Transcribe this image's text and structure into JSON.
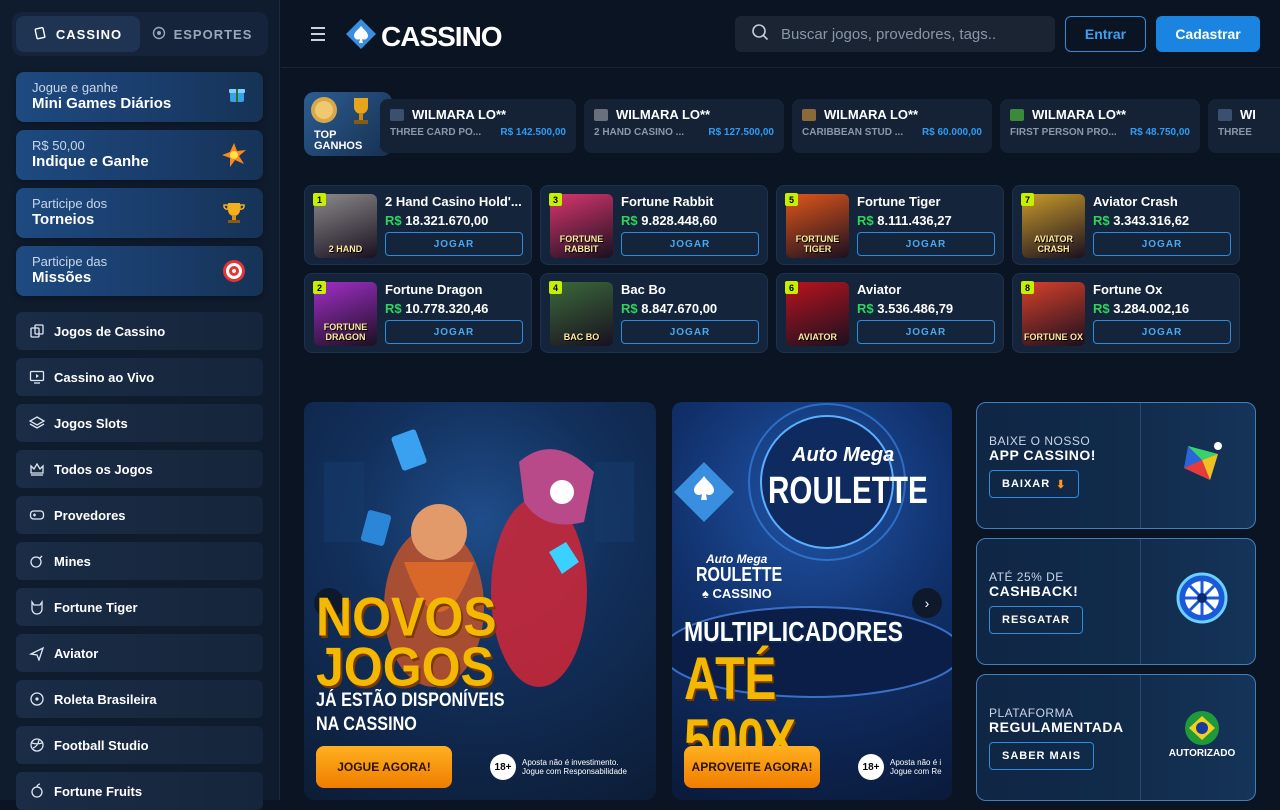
{
  "sidebar": {
    "tabs": [
      {
        "label": "CASSINO",
        "icon": "casino-icon",
        "active": true
      },
      {
        "label": "ESPORTES",
        "icon": "soccer-icon",
        "active": false
      }
    ],
    "promos": [
      {
        "small": "Jogue e ganhe",
        "big": "Mini Games Diários",
        "icon": "gift-icon"
      },
      {
        "small": "R$ 50,00",
        "big": "Indique e Ganhe",
        "icon": "burst-icon"
      },
      {
        "small": "Participe dos",
        "big": "Torneios",
        "icon": "trophy-icon"
      },
      {
        "small": "Participe das",
        "big": "Missões",
        "icon": "target-icon"
      }
    ],
    "nav": [
      "Jogos de Cassino",
      "Cassino ao Vivo",
      "Jogos Slots",
      "Todos os Jogos",
      "Provedores",
      "Mines",
      "Fortune Tiger",
      "Aviator",
      "Roleta Brasileira",
      "Football Studio",
      "Fortune Fruits"
    ]
  },
  "header": {
    "logo": "CASSINO",
    "search_placeholder": "Buscar jogos, provedores, tags..",
    "login": "Entrar",
    "register": "Cadastrar"
  },
  "top_wins": {
    "label": "TOP GANHOS",
    "items": [
      {
        "user": "WILMARA LO**",
        "game": "THREE CARD PO...",
        "amount": "R$ 142.500,00",
        "color": "#3b4f6e"
      },
      {
        "user": "WILMARA LO**",
        "game": "2 HAND CASINO ...",
        "amount": "R$ 127.500,00",
        "color": "#6a6f7e"
      },
      {
        "user": "WILMARA LO**",
        "game": "CARIBBEAN STUD ...",
        "amount": "R$ 60.000,00",
        "color": "#8a6a3a"
      },
      {
        "user": "WILMARA LO**",
        "game": "FIRST PERSON PRO...",
        "amount": "R$ 48.750,00",
        "color": "#3a8a3a"
      },
      {
        "user": "WI",
        "game": "THREE",
        "amount": "",
        "color": "#3b4f6e"
      }
    ]
  },
  "games": [
    {
      "rank": "1",
      "name": "2 Hand Casino Hold'...",
      "currency": "R$",
      "value": "18.321.670,00",
      "thumb": "2 HAND",
      "bg": "#8a8a8a"
    },
    {
      "rank": "3",
      "name": "Fortune Rabbit",
      "currency": "R$",
      "value": "9.828.448,60",
      "thumb": "FORTUNE RABBIT",
      "bg": "#d8366e"
    },
    {
      "rank": "5",
      "name": "Fortune Tiger",
      "currency": "R$",
      "value": "8.111.436,27",
      "thumb": "FORTUNE TIGER",
      "bg": "#e0561a"
    },
    {
      "rank": "7",
      "name": "Aviator Crash",
      "currency": "R$",
      "value": "3.343.316,62",
      "thumb": "AVIATOR CRASH",
      "bg": "#c89a2a"
    },
    {
      "rank": "2",
      "name": "Fortune Dragon",
      "currency": "R$",
      "value": "10.778.320,46",
      "thumb": "FORTUNE DRAGON",
      "bg": "#a22ec8"
    },
    {
      "rank": "4",
      "name": "Bac Bo",
      "currency": "R$",
      "value": "8.847.670,00",
      "thumb": "BAC BO",
      "bg": "#3a6a3a"
    },
    {
      "rank": "6",
      "name": "Aviator",
      "currency": "R$",
      "value": "3.536.486,79",
      "thumb": "AVIATOR",
      "bg": "#b8141e"
    },
    {
      "rank": "8",
      "name": "Fortune Ox",
      "currency": "R$",
      "value": "3.284.002,16",
      "thumb": "FORTUNE OX",
      "bg": "#d8402a"
    }
  ],
  "play_label": "JOGAR",
  "banner1": {
    "title1": "NOVOS",
    "title2": "JOGOS",
    "sub1": "JÁ ESTÃO DISPONÍVEIS",
    "sub2": "NA CASSINO",
    "cta": "JOGUE AGORA!",
    "age": "18+",
    "notice1": "Aposta não é investimento.",
    "notice2": "Jogue com Responsabilidade"
  },
  "banner2": {
    "brand1": "Auto Mega",
    "brand2": "ROULETTE",
    "small1": "Auto Mega",
    "small2": "ROULETTE",
    "small3": "CASSINO",
    "title1": "MULTIPLICADORES",
    "title2": "ATÉ 500X",
    "cta": "APROVEITE AGORA!",
    "age": "18+",
    "notice1": "Aposta não é i",
    "notice2": "Jogue com Re"
  },
  "side_cards": [
    {
      "small": "BAIXE O NOSSO",
      "big": "APP CASSINO!",
      "button": "BAIXAR",
      "art": "app-icon"
    },
    {
      "small": "ATÉ 25% DE",
      "big": "CASHBACK!",
      "button": "RESGATAR",
      "art": "wheel-icon"
    },
    {
      "small": "PLATAFORMA",
      "big": "REGULAMENTADA",
      "button": "SABER MAIS",
      "art": "brazil-seal-icon",
      "seal": "AUTORIZADO"
    }
  ]
}
